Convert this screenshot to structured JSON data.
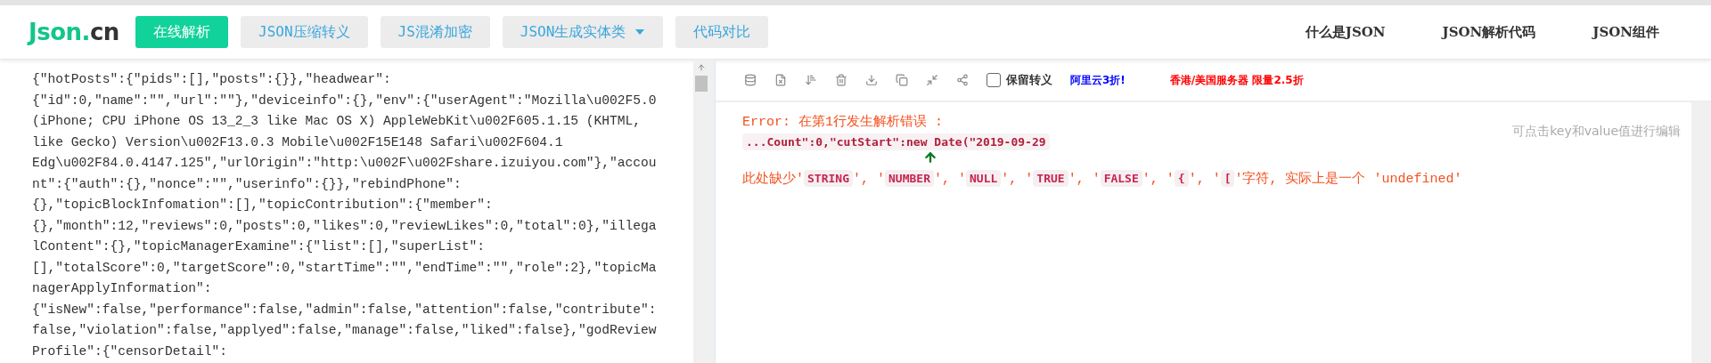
{
  "header": {
    "logo": {
      "main": "Json.",
      "suffix": "cn"
    },
    "nav": [
      {
        "label": "在线解析",
        "selected": true,
        "kind": "plain"
      },
      {
        "label": "JSON压缩转义",
        "selected": false,
        "kind": "plain"
      },
      {
        "label": "JS混淆加密",
        "selected": false,
        "kind": "plain"
      },
      {
        "label": "JSON生成实体类",
        "selected": false,
        "kind": "dropdown"
      },
      {
        "label": "代码对比",
        "selected": false,
        "kind": "plain"
      }
    ],
    "links": [
      "什么是JSON",
      "JSON解析代码",
      "JSON组件"
    ]
  },
  "editor": {
    "lines": [
      "{\"hotPosts\":{\"pids\":[],\"posts\":{}},\"headwear\":",
      "{\"id\":0,\"name\":\"\",\"url\":\"\"},\"deviceinfo\":{},\"env\":{\"userAgent\":\"Mozilla\\u002F5.0",
      "(iPhone; CPU iPhone OS 13_2_3 like Mac OS X) AppleWebKit\\u002F605.1.15 (KHTML,",
      "like Gecko) Version\\u002F13.0.3 Mobile\\u002F15E148 Safari\\u002F604.1",
      "Edg\\u002F84.0.4147.125\",\"urlOrigin\":\"http:\\u002F\\u002Fshare.izuiyou.com\"},\"accou",
      "nt\":{\"auth\":{},\"nonce\":\"\",\"userinfo\":{}},\"rebindPhone\":",
      "{},\"topicBlockInfomation\":[],\"topicContribution\":{\"member\":",
      "{},\"month\":12,\"reviews\":0,\"posts\":0,\"likes\":0,\"reviewLikes\":0,\"total\":0},\"illega",
      "lContent\":{},\"topicManagerExamine\":{\"list\":[],\"superList\":",
      "[],\"totalScore\":0,\"targetScore\":0,\"startTime\":\"\",\"endTime\":\"\",\"role\":2},\"topicMa",
      "nagerApplyInformation\":",
      "{\"isNew\":false,\"performance\":false,\"admin\":false,\"attention\":false,\"contribute\":",
      "false,\"violation\":false,\"applyed\":false,\"manage\":false,\"liked\":false},\"godReview",
      "Profile\":{\"censorDetail\":"
    ]
  },
  "toolbar": {
    "escape": {
      "label": "保留转义",
      "checked": false
    },
    "ads": [
      {
        "text": "阿里云3折!",
        "color": "#0000ff"
      },
      {
        "text": "香港/美国服务器 限量2.5折",
        "color": "#ff0000"
      }
    ]
  },
  "result": {
    "hint": "可点击key和value值进行编辑",
    "error_title": "Error: 在第1行发生解析错误 :",
    "snippet": "...Count\":0,\"cutStart\":new Date(\"2019-09-29",
    "message": [
      {
        "kind": "text",
        "text": "此处缺少'"
      },
      {
        "kind": "code",
        "text": "STRING"
      },
      {
        "kind": "text",
        "text": "', '"
      },
      {
        "kind": "code",
        "text": "NUMBER"
      },
      {
        "kind": "text",
        "text": "', '"
      },
      {
        "kind": "code",
        "text": "NULL"
      },
      {
        "kind": "text",
        "text": "', '"
      },
      {
        "kind": "code",
        "text": "TRUE"
      },
      {
        "kind": "text",
        "text": "', '"
      },
      {
        "kind": "code",
        "text": "FALSE"
      },
      {
        "kind": "text",
        "text": "', '"
      },
      {
        "kind": "code",
        "text": "{"
      },
      {
        "kind": "text",
        "text": "', '"
      },
      {
        "kind": "code",
        "text": "["
      },
      {
        "kind": "text",
        "text": "'字符, 实际上是一个 'undefined'"
      }
    ]
  }
}
